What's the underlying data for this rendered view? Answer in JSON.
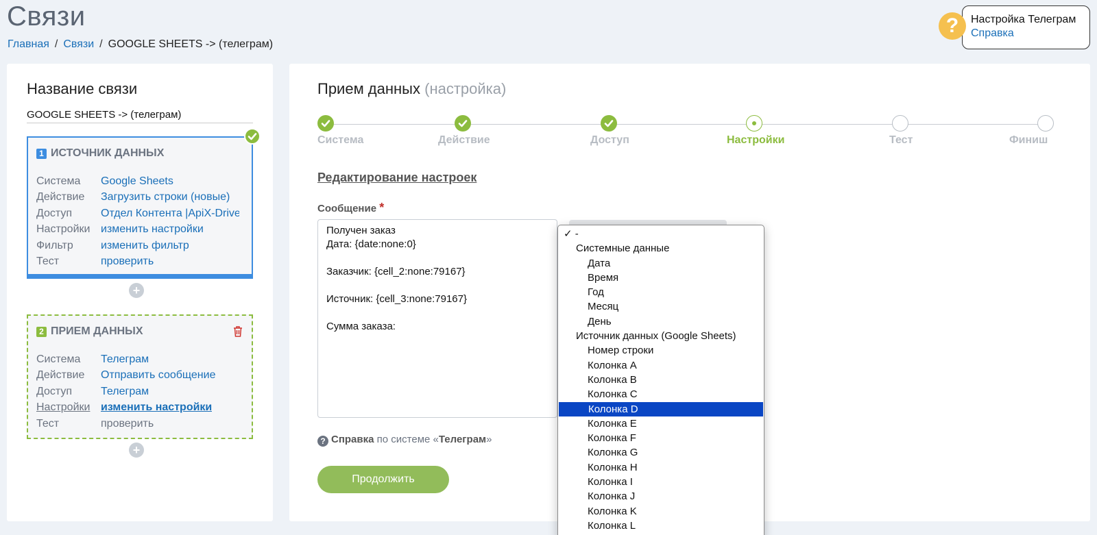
{
  "header": {
    "title": "Связи",
    "breadcrumb": [
      "Главная",
      "Связи",
      "GOOGLE SHEETS -> (телеграм)"
    ],
    "help": {
      "title": "Настройка Телеграм",
      "link": "Справка"
    }
  },
  "left": {
    "title": "Название связи",
    "connection_name": "GOOGLE SHEETS -> (телеграм)",
    "source": {
      "number": "1",
      "heading": "ИСТОЧНИК ДАННЫХ",
      "rows": [
        {
          "key": "Система",
          "value": "Google Sheets"
        },
        {
          "key": "Действие",
          "value": "Загрузить строки (новые)"
        },
        {
          "key": "Доступ",
          "value": "Отдел Контента |ApiX-Drive"
        },
        {
          "key": "Настройки",
          "value": "изменить настройки"
        },
        {
          "key": "Фильтр",
          "value": "изменить фильтр"
        },
        {
          "key": "Тест",
          "value": "проверить"
        }
      ]
    },
    "destination": {
      "number": "2",
      "heading": "ПРИЕМ ДАННЫХ",
      "rows": [
        {
          "key": "Система",
          "value": "Телеграм"
        },
        {
          "key": "Действие",
          "value": "Отправить сообщение"
        },
        {
          "key": "Доступ",
          "value": "Телеграм"
        },
        {
          "key": "Настройки",
          "value": "изменить настройки"
        },
        {
          "key": "Тест",
          "value": "проверить"
        }
      ]
    }
  },
  "main": {
    "title": "Прием данных",
    "title_sub": "(настройка)",
    "steps": [
      "Система",
      "Действие",
      "Доступ",
      "Настройки",
      "Тест",
      "Финиш"
    ],
    "current_step": 3,
    "section_title": "Редактирование настроек",
    "field_label": "Сообщение",
    "required_mark": "*",
    "message": "Получен заказ\nДата: {date:none:0}\n\nЗаказчик: {cell_2:none:79167}\n\nИсточник: {cell_3:none:79167}\n\nСумма заказа:",
    "hint": {
      "bold": "Справка",
      "text": " по системе «",
      "system": "Телеграм",
      "end": "»"
    },
    "continue": "Продолжить"
  },
  "dropdown": {
    "items": [
      {
        "label": "✓ -",
        "level": 0
      },
      {
        "label": "Системные данные",
        "level": 1
      },
      {
        "label": "Дата",
        "level": 2
      },
      {
        "label": "Время",
        "level": 2
      },
      {
        "label": "Год",
        "level": 2
      },
      {
        "label": "Месяц",
        "level": 2
      },
      {
        "label": "День",
        "level": 2
      },
      {
        "label": "Источник данных (Google Sheets)",
        "level": 1
      },
      {
        "label": "Номер строки",
        "level": 2
      },
      {
        "label": "Колонка A",
        "level": 2
      },
      {
        "label": "Колонка B",
        "level": 2
      },
      {
        "label": "Колонка C",
        "level": 2
      },
      {
        "label": "Колонка D",
        "level": 2,
        "selected": true
      },
      {
        "label": "Колонка E",
        "level": 2
      },
      {
        "label": "Колонка F",
        "level": 2
      },
      {
        "label": "Колонка G",
        "level": 2
      },
      {
        "label": "Колонка H",
        "level": 2
      },
      {
        "label": "Колонка I",
        "level": 2
      },
      {
        "label": "Колонка J",
        "level": 2
      },
      {
        "label": "Колонка K",
        "level": 2
      },
      {
        "label": "Колонка L",
        "level": 2
      }
    ]
  },
  "colors": {
    "accent_green": "#8cbc3f",
    "link_blue": "#1a6fb8",
    "selection": "#0a46c4",
    "source_border": "#3d8de0"
  },
  "icons": [
    "check-icon",
    "question-icon",
    "trash-icon",
    "plus-icon",
    "checkmark-icon"
  ]
}
